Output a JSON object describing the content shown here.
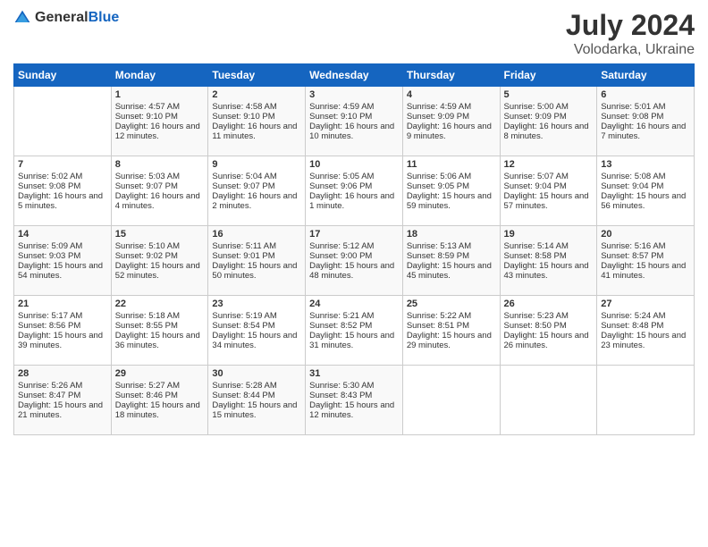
{
  "header": {
    "logo_general": "General",
    "logo_blue": "Blue",
    "month_year": "July 2024",
    "location": "Volodarka, Ukraine"
  },
  "weekdays": [
    "Sunday",
    "Monday",
    "Tuesday",
    "Wednesday",
    "Thursday",
    "Friday",
    "Saturday"
  ],
  "weeks": [
    [
      {
        "day": "",
        "info": ""
      },
      {
        "day": "1",
        "info": "Sunrise: 4:57 AM\nSunset: 9:10 PM\nDaylight: 16 hours and 12 minutes."
      },
      {
        "day": "2",
        "info": "Sunrise: 4:58 AM\nSunset: 9:10 PM\nDaylight: 16 hours and 11 minutes."
      },
      {
        "day": "3",
        "info": "Sunrise: 4:59 AM\nSunset: 9:10 PM\nDaylight: 16 hours and 10 minutes."
      },
      {
        "day": "4",
        "info": "Sunrise: 4:59 AM\nSunset: 9:09 PM\nDaylight: 16 hours and 9 minutes."
      },
      {
        "day": "5",
        "info": "Sunrise: 5:00 AM\nSunset: 9:09 PM\nDaylight: 16 hours and 8 minutes."
      },
      {
        "day": "6",
        "info": "Sunrise: 5:01 AM\nSunset: 9:08 PM\nDaylight: 16 hours and 7 minutes."
      }
    ],
    [
      {
        "day": "7",
        "info": "Sunrise: 5:02 AM\nSunset: 9:08 PM\nDaylight: 16 hours and 5 minutes."
      },
      {
        "day": "8",
        "info": "Sunrise: 5:03 AM\nSunset: 9:07 PM\nDaylight: 16 hours and 4 minutes."
      },
      {
        "day": "9",
        "info": "Sunrise: 5:04 AM\nSunset: 9:07 PM\nDaylight: 16 hours and 2 minutes."
      },
      {
        "day": "10",
        "info": "Sunrise: 5:05 AM\nSunset: 9:06 PM\nDaylight: 16 hours and 1 minute."
      },
      {
        "day": "11",
        "info": "Sunrise: 5:06 AM\nSunset: 9:05 PM\nDaylight: 15 hours and 59 minutes."
      },
      {
        "day": "12",
        "info": "Sunrise: 5:07 AM\nSunset: 9:04 PM\nDaylight: 15 hours and 57 minutes."
      },
      {
        "day": "13",
        "info": "Sunrise: 5:08 AM\nSunset: 9:04 PM\nDaylight: 15 hours and 56 minutes."
      }
    ],
    [
      {
        "day": "14",
        "info": "Sunrise: 5:09 AM\nSunset: 9:03 PM\nDaylight: 15 hours and 54 minutes."
      },
      {
        "day": "15",
        "info": "Sunrise: 5:10 AM\nSunset: 9:02 PM\nDaylight: 15 hours and 52 minutes."
      },
      {
        "day": "16",
        "info": "Sunrise: 5:11 AM\nSunset: 9:01 PM\nDaylight: 15 hours and 50 minutes."
      },
      {
        "day": "17",
        "info": "Sunrise: 5:12 AM\nSunset: 9:00 PM\nDaylight: 15 hours and 48 minutes."
      },
      {
        "day": "18",
        "info": "Sunrise: 5:13 AM\nSunset: 8:59 PM\nDaylight: 15 hours and 45 minutes."
      },
      {
        "day": "19",
        "info": "Sunrise: 5:14 AM\nSunset: 8:58 PM\nDaylight: 15 hours and 43 minutes."
      },
      {
        "day": "20",
        "info": "Sunrise: 5:16 AM\nSunset: 8:57 PM\nDaylight: 15 hours and 41 minutes."
      }
    ],
    [
      {
        "day": "21",
        "info": "Sunrise: 5:17 AM\nSunset: 8:56 PM\nDaylight: 15 hours and 39 minutes."
      },
      {
        "day": "22",
        "info": "Sunrise: 5:18 AM\nSunset: 8:55 PM\nDaylight: 15 hours and 36 minutes."
      },
      {
        "day": "23",
        "info": "Sunrise: 5:19 AM\nSunset: 8:54 PM\nDaylight: 15 hours and 34 minutes."
      },
      {
        "day": "24",
        "info": "Sunrise: 5:21 AM\nSunset: 8:52 PM\nDaylight: 15 hours and 31 minutes."
      },
      {
        "day": "25",
        "info": "Sunrise: 5:22 AM\nSunset: 8:51 PM\nDaylight: 15 hours and 29 minutes."
      },
      {
        "day": "26",
        "info": "Sunrise: 5:23 AM\nSunset: 8:50 PM\nDaylight: 15 hours and 26 minutes."
      },
      {
        "day": "27",
        "info": "Sunrise: 5:24 AM\nSunset: 8:48 PM\nDaylight: 15 hours and 23 minutes."
      }
    ],
    [
      {
        "day": "28",
        "info": "Sunrise: 5:26 AM\nSunset: 8:47 PM\nDaylight: 15 hours and 21 minutes."
      },
      {
        "day": "29",
        "info": "Sunrise: 5:27 AM\nSunset: 8:46 PM\nDaylight: 15 hours and 18 minutes."
      },
      {
        "day": "30",
        "info": "Sunrise: 5:28 AM\nSunset: 8:44 PM\nDaylight: 15 hours and 15 minutes."
      },
      {
        "day": "31",
        "info": "Sunrise: 5:30 AM\nSunset: 8:43 PM\nDaylight: 15 hours and 12 minutes."
      },
      {
        "day": "",
        "info": ""
      },
      {
        "day": "",
        "info": ""
      },
      {
        "day": "",
        "info": ""
      }
    ]
  ]
}
